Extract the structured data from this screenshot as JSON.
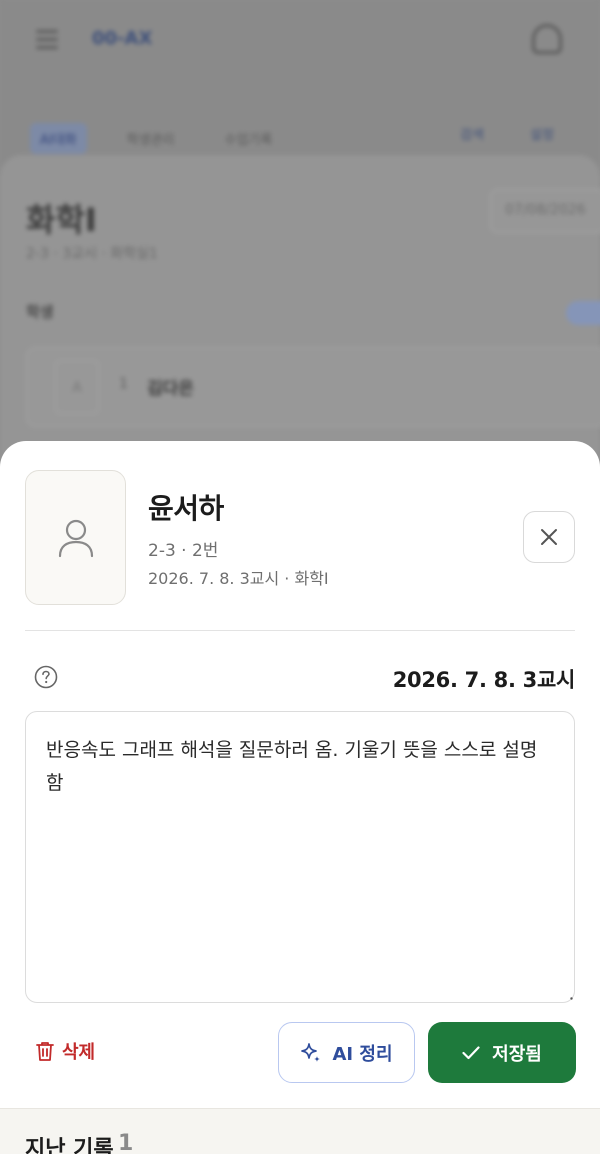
{
  "background": {
    "logo": "00-AX",
    "tabs": [
      "AI대화",
      "학생관리",
      "수업기록"
    ],
    "tab_right": [
      "검색",
      "설정"
    ],
    "course_title": "화학I",
    "course_sub": "2-3 · 3교시 · 화학실1",
    "date_field": "07/08/2026",
    "section_label": "학생",
    "row_avatar": "A",
    "row_number": "1",
    "row_name": "김다은"
  },
  "sheet": {
    "student_name": "윤서하",
    "student_class": "2-3 · 2번",
    "student_meta": "2026. 7. 8. 3교시 · 화학I",
    "note_date": "2026. 7. 8. 3교시",
    "note_text": "반응속도 그래프 해석을 질문하러 옴. 기울기 뜻을 스스로 설명함",
    "delete_label": "삭제",
    "ai_label": "AI 정리",
    "save_label": "저장됨",
    "history_title": "지난 기록",
    "history_count": "1"
  },
  "colors": {
    "save_button": "#1e7a3c",
    "delete_text": "#c22a2a",
    "ai_text": "#2f4d9c",
    "ai_border": "#b9c8f0"
  },
  "icons": [
    "menu-icon",
    "bell-icon",
    "user-icon",
    "close-icon",
    "help-icon",
    "trash-icon",
    "sparkle-icon",
    "check-icon"
  ]
}
